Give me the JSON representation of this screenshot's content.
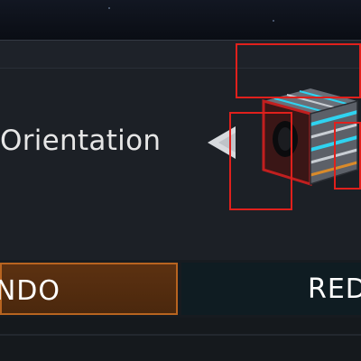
{
  "control": {
    "label": "Orientation",
    "arrow_icon": "triangle-left-icon"
  },
  "buttons": {
    "undo_label": "NDO",
    "redo_label": "RED"
  },
  "colors": {
    "undo_fill": "#5c3111",
    "undo_border": "#b86420",
    "redo_fill": "#0f1c22",
    "cube_stripe": "#2fd3f0",
    "highlight": "#e0201c"
  }
}
